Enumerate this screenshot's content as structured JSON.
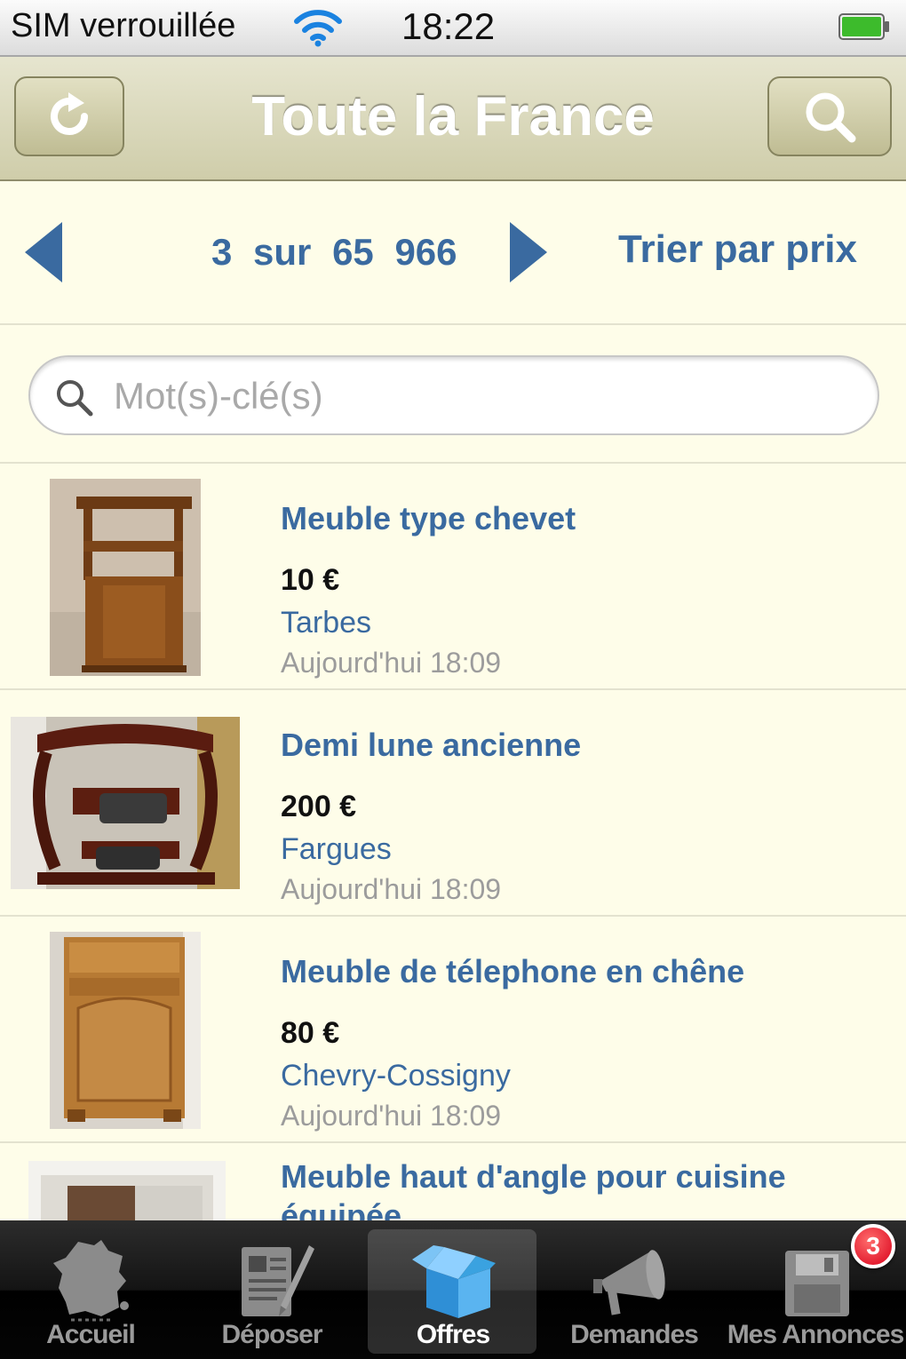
{
  "status_bar": {
    "carrier": "SIM verrouillée",
    "time": "18:22",
    "icons": [
      "wifi-icon",
      "battery-icon"
    ]
  },
  "nav": {
    "title": "Toute la France",
    "left_icon": "refresh-icon",
    "right_icon": "search-icon"
  },
  "pager": {
    "current": "3",
    "separator": "sur",
    "total": "65 966",
    "prev_icon": "arrow-left-icon",
    "next_icon": "arrow-right-icon",
    "sort_label": "Trier par prix"
  },
  "search": {
    "placeholder": "Mot(s)-clé(s)",
    "value": ""
  },
  "listings": [
    {
      "title": "Meuble type chevet",
      "price": "10 €",
      "city": "Tarbes",
      "date": "Aujourd'hui 18:09"
    },
    {
      "title": "Demi lune ancienne",
      "price": "200 €",
      "city": "Fargues",
      "date": "Aujourd'hui 18:09"
    },
    {
      "title": "Meuble de télephone en chêne",
      "price": "80 €",
      "city": "Chevry-Cossigny",
      "date": "Aujourd'hui 18:09"
    },
    {
      "title": "Meuble haut d'angle pour cuisine équipée",
      "price": "",
      "city": "",
      "date": ""
    }
  ],
  "tabs": [
    {
      "label": "Accueil",
      "icon": "france-map-icon"
    },
    {
      "label": "Déposer",
      "icon": "deposit-form-icon"
    },
    {
      "label": "Offres",
      "icon": "open-box-icon",
      "active": true
    },
    {
      "label": "Demandes",
      "icon": "megaphone-icon"
    },
    {
      "label": "Mes Annonces",
      "icon": "floppy-disk-icon"
    }
  ],
  "badge": {
    "count": "3"
  },
  "colors": {
    "link_blue": "#3a6aa0",
    "background": "#fefde9",
    "navbar": "#d8d6b6",
    "badge_red": "#d9001a",
    "active_tab_icon": "#3aa2e0"
  }
}
